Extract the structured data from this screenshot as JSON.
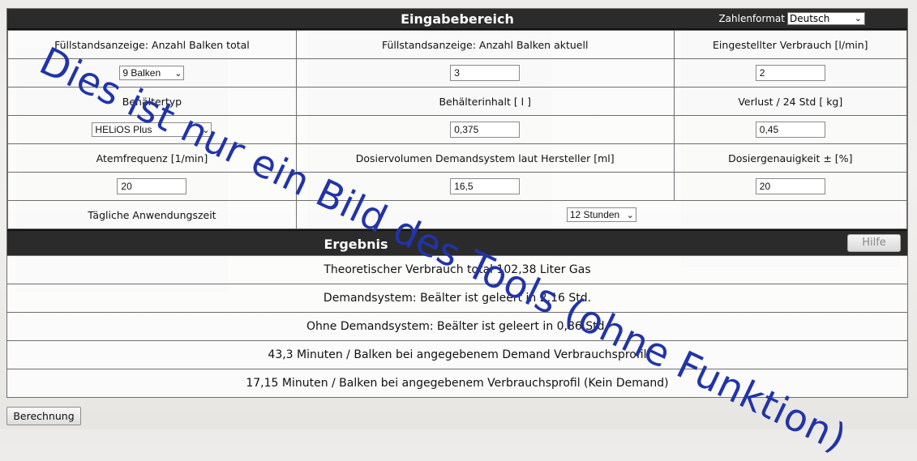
{
  "header": {
    "title": "Eingabebereich",
    "numformat_label": "Zahlenformat",
    "numformat_value": "Deutsch"
  },
  "inputs": {
    "r1": {
      "c1_label": "Füllstandsanzeige: Anzahl Balken total",
      "c2_label": "Füllstandsanzeige: Anzahl Balken aktuell",
      "c3_label": "Eingestellter Verbrauch [l/min]",
      "c1_value": "9 Balken",
      "c2_value": "3",
      "c3_value": "2"
    },
    "r2": {
      "c1_label": "Behältertyp",
      "c2_label": "Behälterinhalt [ l ]",
      "c3_label": "Verlust / 24 Std [ kg]",
      "c1_value": "HELiOS Plus",
      "c2_value": "0,375",
      "c3_value": "0,45"
    },
    "r3": {
      "c1_label": "Atemfrequenz [1/min]",
      "c2_label": "Dosiervolumen Demandsystem laut Hersteller [ml]",
      "c3_label": "Dosiergenauigkeit ± [%]",
      "c1_value": "20",
      "c2_value": "16,5",
      "c3_value": "20"
    },
    "r4": {
      "label": "Tägliche Anwendungszeit",
      "value": "12 Stunden"
    }
  },
  "result": {
    "title": "Ergebnis",
    "help_label": "Hilfe",
    "rows": [
      "Theoretischer Verbrauch total 102,38 Liter Gas",
      "Demandsystem: Beälter ist geleert in 2,16 Std.",
      "Ohne Demandsystem: Beälter ist geleert in 0,86 Std.",
      "43,3 Minuten / Balken bei angegebenem Demand Verbrauchsprofil",
      "17,15 Minuten / Balken bei angegebenem Verbrauchsprofil (Kein Demand)"
    ]
  },
  "calc_button": "Berechnung",
  "watermark": "Dies ist nur ein Bild des Tools (ohne Funktion)",
  "colors": {
    "bar": "#2b2b2b",
    "watermark": "#2134a8"
  },
  "icons": {
    "dropdown": "chevron-down-icon"
  }
}
